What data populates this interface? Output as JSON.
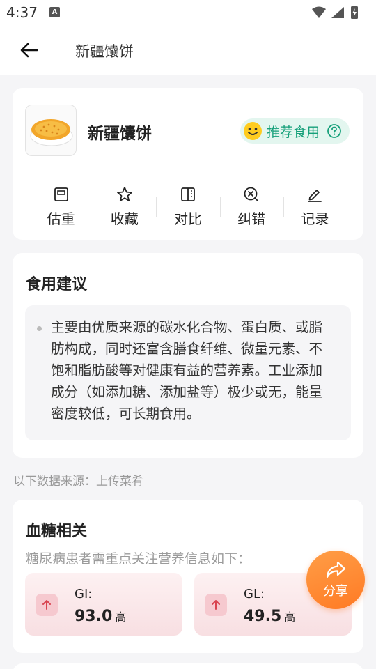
{
  "status_bar": {
    "time": "4:37",
    "badge": "A"
  },
  "app_bar": {
    "title": "新疆馕饼"
  },
  "food": {
    "name": "新疆馕饼",
    "recommendation": "推荐食用",
    "actions": [
      {
        "label": "估重",
        "icon": "scale-icon"
      },
      {
        "label": "收藏",
        "icon": "star-icon"
      },
      {
        "label": "对比",
        "icon": "compare-icon"
      },
      {
        "label": "纠错",
        "icon": "error-icon"
      },
      {
        "label": "记录",
        "icon": "edit-icon"
      }
    ]
  },
  "advice": {
    "title": "食用建议",
    "text": "主要由优质来源的碳水化合物、蛋白质、或脂肪构成，同时还富含膳食纤维、微量元素、不饱和脂肪酸等对健康有益的营养素。工业添加成分（如添加糖、添加盐等）极少或无，能量密度较低，可长期食用。"
  },
  "source": "以下数据来源：上传菜肴",
  "blood_sugar": {
    "title": "血糖相关",
    "subtitle": "糖尿病患者需重点关注营养信息如下：",
    "metrics": [
      {
        "label": "GI:",
        "value": "93.0",
        "level": "高"
      },
      {
        "label": "GL:",
        "value": "49.5",
        "level": "高"
      }
    ]
  },
  "share": {
    "label": "分享"
  },
  "colors": {
    "accent_green": "#16a07a",
    "accent_orange": "#ff8a33",
    "alert_red": "#d9434f"
  }
}
